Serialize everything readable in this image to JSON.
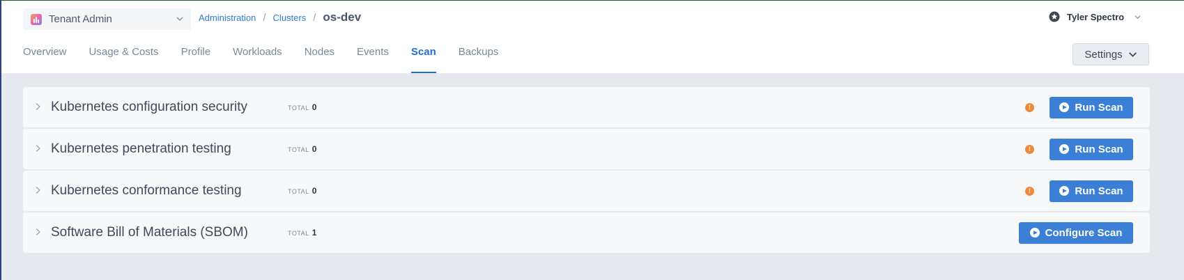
{
  "header": {
    "tenant": {
      "name": "Tenant Admin"
    },
    "breadcrumb": {
      "items": [
        "Administration",
        "Clusters"
      ],
      "current": "os-dev",
      "separator": "/"
    },
    "user": {
      "name": "Tyler Spectro"
    },
    "tabs": [
      "Overview",
      "Usage & Costs",
      "Profile",
      "Workloads",
      "Nodes",
      "Events",
      "Scan",
      "Backups"
    ],
    "active_tab": "Scan",
    "settings_label": "Settings"
  },
  "scans": [
    {
      "title": "Kubernetes configuration security",
      "total_label": "TOTAL",
      "total": "0",
      "warning": true,
      "warning_symbol": "!",
      "button": "Run Scan"
    },
    {
      "title": "Kubernetes penetration testing",
      "total_label": "TOTAL",
      "total": "0",
      "warning": true,
      "warning_symbol": "!",
      "button": "Run Scan"
    },
    {
      "title": "Kubernetes conformance testing",
      "total_label": "TOTAL",
      "total": "0",
      "warning": true,
      "warning_symbol": "!",
      "button": "Run Scan"
    },
    {
      "title": "Software Bill of Materials (SBOM)",
      "total_label": "TOTAL",
      "total": "1",
      "warning": false,
      "button": "Configure Scan"
    }
  ],
  "colors": {
    "accent": "#1e6fd9",
    "button": "#3b7fd6",
    "warning": "#f0883a",
    "content_bg": "#e6e9ed"
  },
  "icons": {
    "tenant": "tenant-logo-icon",
    "chevron": "chevron-down-icon",
    "user": "star-badge-icon",
    "row": "chevron-right-icon",
    "warning": "warning-icon",
    "play": "play-circle-icon"
  }
}
